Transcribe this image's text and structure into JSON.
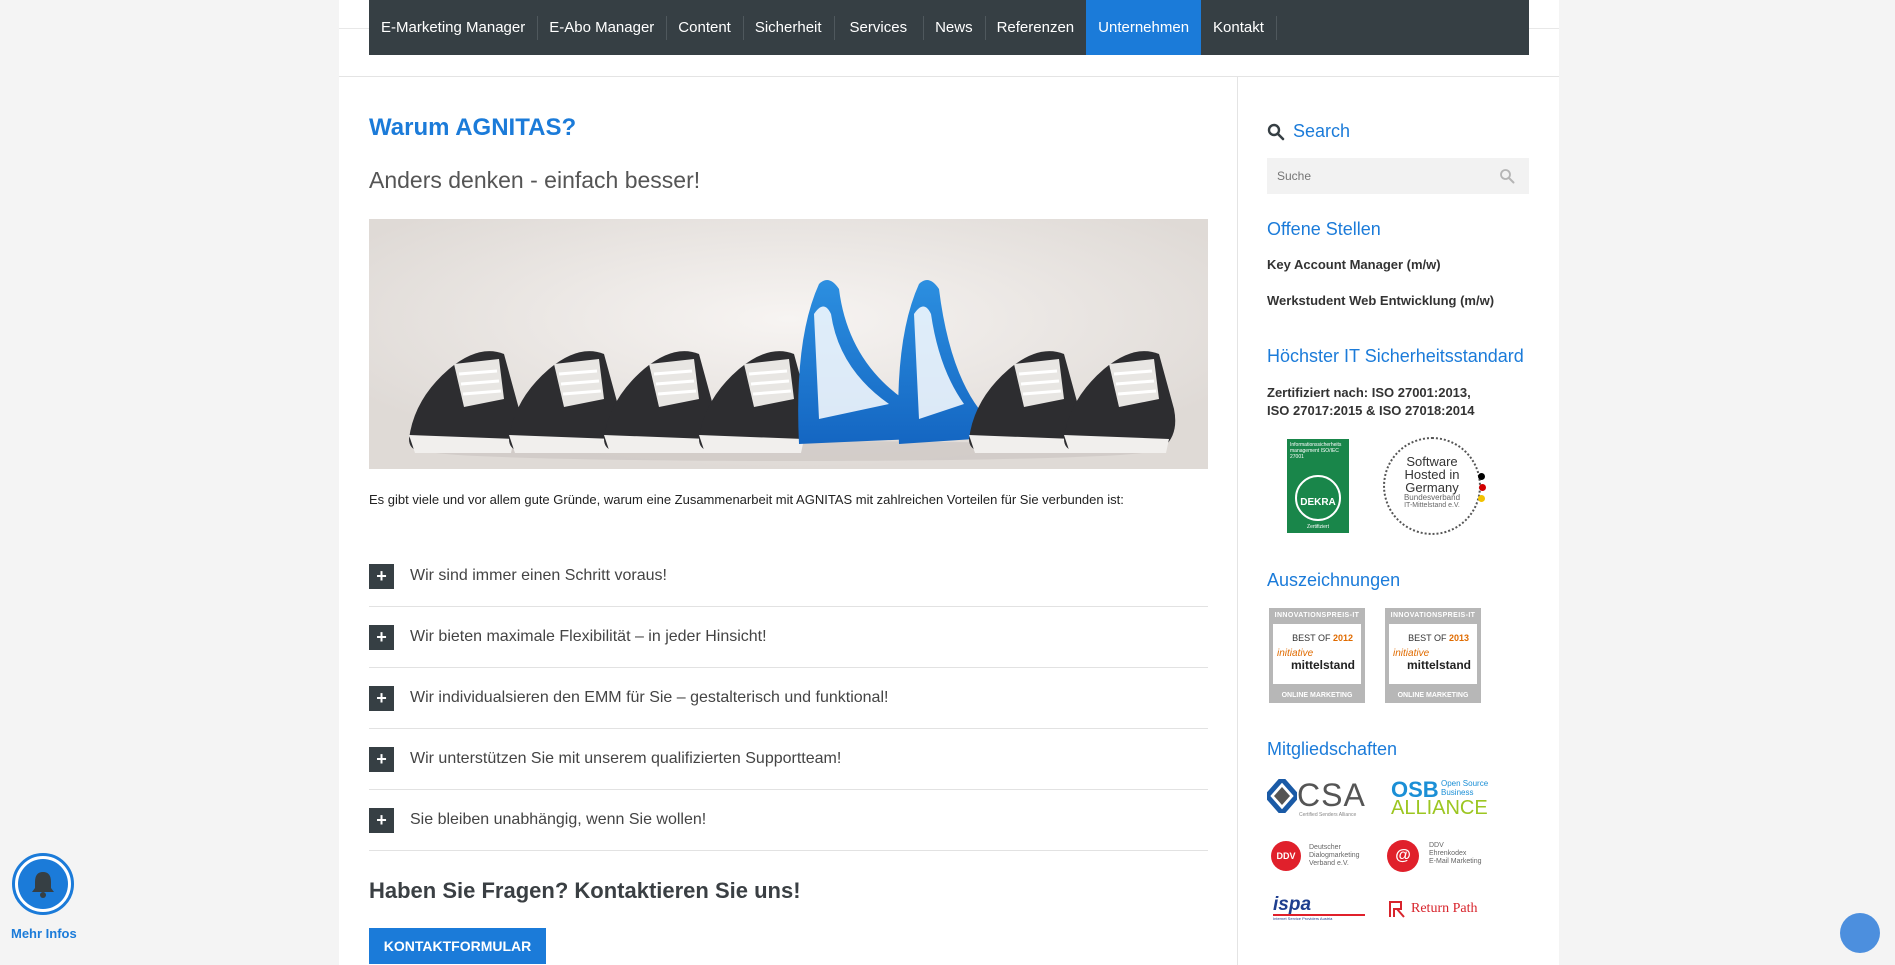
{
  "nav": {
    "items": [
      "E-Marketing Manager",
      "E-Abo Manager",
      "Content",
      "Sicherheit",
      "Services",
      "News",
      "Referenzen",
      "Unternehmen",
      "Kontakt"
    ],
    "active": "Unternehmen"
  },
  "main": {
    "title": "Warum AGNITAS?",
    "subtitle": "Anders denken - einfach besser!",
    "intro": "Es gibt viele und vor allem gute Gründe, warum eine Zusammenarbeit mit AGNITAS mit zahlreichen Vorteilen für Sie verbunden ist:",
    "accordion": [
      "Wir sind immer einen Schritt voraus!",
      "Wir bieten maximale Flexibilität – in jeder Hinsicht!",
      "Wir individualsieren den EMM für Sie – gestalterisch und funktional!",
      "Wir unterstützen Sie mit unserem qualifizierten Supportteam!",
      "Sie bleiben unabhängig, wenn Sie wollen!"
    ],
    "accordion_icon": "+",
    "contact_heading": "Haben Sie Fragen? Kontaktieren Sie uns!",
    "contact_button": "KONTAKTFORMULAR"
  },
  "sidebar": {
    "search_title": "Search",
    "search_placeholder": "Suche",
    "jobs_title": "Offene Stellen",
    "jobs": [
      "Key Account Manager (m/w)",
      "Werkstudent Web Entwicklung (m/w)"
    ],
    "security_title": "Höchster IT Sicherheitsstandard",
    "cert_line1": "Zertifiziert nach: ISO 27001:2013,",
    "cert_line2": "ISO 27017:2015 & ISO 27018:2014",
    "dekra": {
      "small": "Informationssicherheits management ISO/IEC 27001",
      "name": "DEKRA",
      "sub": "Zertifiziert"
    },
    "hosted": {
      "l1": "Software",
      "l2": "Hosted in",
      "l3": "Germany",
      "l4": "Bundesverband",
      "l5": "IT-Mittelstand e.V."
    },
    "awards_title": "Auszeichnungen",
    "awards": [
      {
        "top": "INNOVATIONSPREIS-IT",
        "best": "BEST OF",
        "year": "2012",
        "script": "initiative",
        "brand": "mittelstand",
        "bottom": "ONLINE MARKETING"
      },
      {
        "top": "INNOVATIONSPREIS-IT",
        "best": "BEST OF",
        "year": "2013",
        "script": "initiative",
        "brand": "mittelstand",
        "bottom": "ONLINE MARKETING"
      }
    ],
    "members_title": "Mitgliedschaften",
    "members": {
      "csa": "CSA",
      "csa_sub": "Certified Senders Alliance",
      "osb1": "OSB",
      "osb2": "Open Source",
      "osb3": "Business",
      "osb4": "ALLIANCE",
      "ddv": "DDV",
      "ddv_text": [
        "Deutscher",
        "Dialogmarketing",
        "Verband e.V."
      ],
      "ddv2_text": [
        "DDV",
        "Ehrenkodex",
        "E-Mail Marketing"
      ],
      "ispa": "ispa",
      "ispa_sub": "Internet Service Providers Austria",
      "returnpath": "Return Path"
    }
  },
  "float": {
    "bell_label": "Mehr Infos"
  },
  "colors": {
    "accent": "#1b7bd9",
    "nav_bg": "#363f44"
  }
}
